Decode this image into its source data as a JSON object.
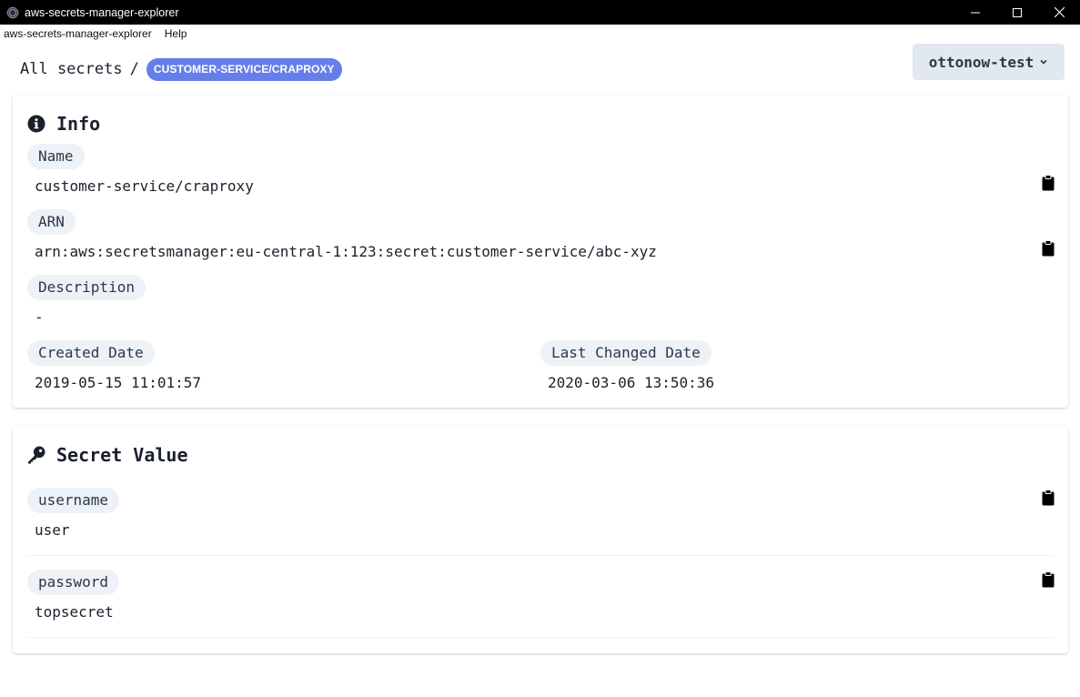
{
  "window": {
    "title": "aws-secrets-manager-explorer"
  },
  "menu": {
    "items": [
      "aws-secrets-manager-explorer",
      "Help"
    ]
  },
  "breadcrumb": {
    "root": "All secrets",
    "separator": "/",
    "current": "CUSTOMER-SERVICE/CRAPROXY"
  },
  "profile": {
    "selected": "ottonow-test"
  },
  "info": {
    "title": "Info",
    "name_label": "Name",
    "name_value": "customer-service/craproxy",
    "arn_label": "ARN",
    "arn_value": "arn:aws:secretsmanager:eu-central-1:123:secret:customer-service/abc-xyz",
    "description_label": "Description",
    "description_value": "-",
    "created_label": "Created Date",
    "created_value": "2019-05-15 11:01:57",
    "changed_label": "Last Changed Date",
    "changed_value": "2020-03-06 13:50:36"
  },
  "secret": {
    "title": "Secret Value",
    "entries": [
      {
        "key": "username",
        "value": "user"
      },
      {
        "key": "password",
        "value": "topsecret"
      }
    ]
  },
  "colors": {
    "accent": "#667eea",
    "pill_bg": "#edf2f7",
    "select_bg": "#e2e8f0",
    "titlebar_bg": "#000000"
  },
  "icons": {
    "info": "info-circle-icon",
    "secret": "key-icon",
    "copy": "clipboard-icon",
    "dropdown": "chevron-down-icon"
  }
}
